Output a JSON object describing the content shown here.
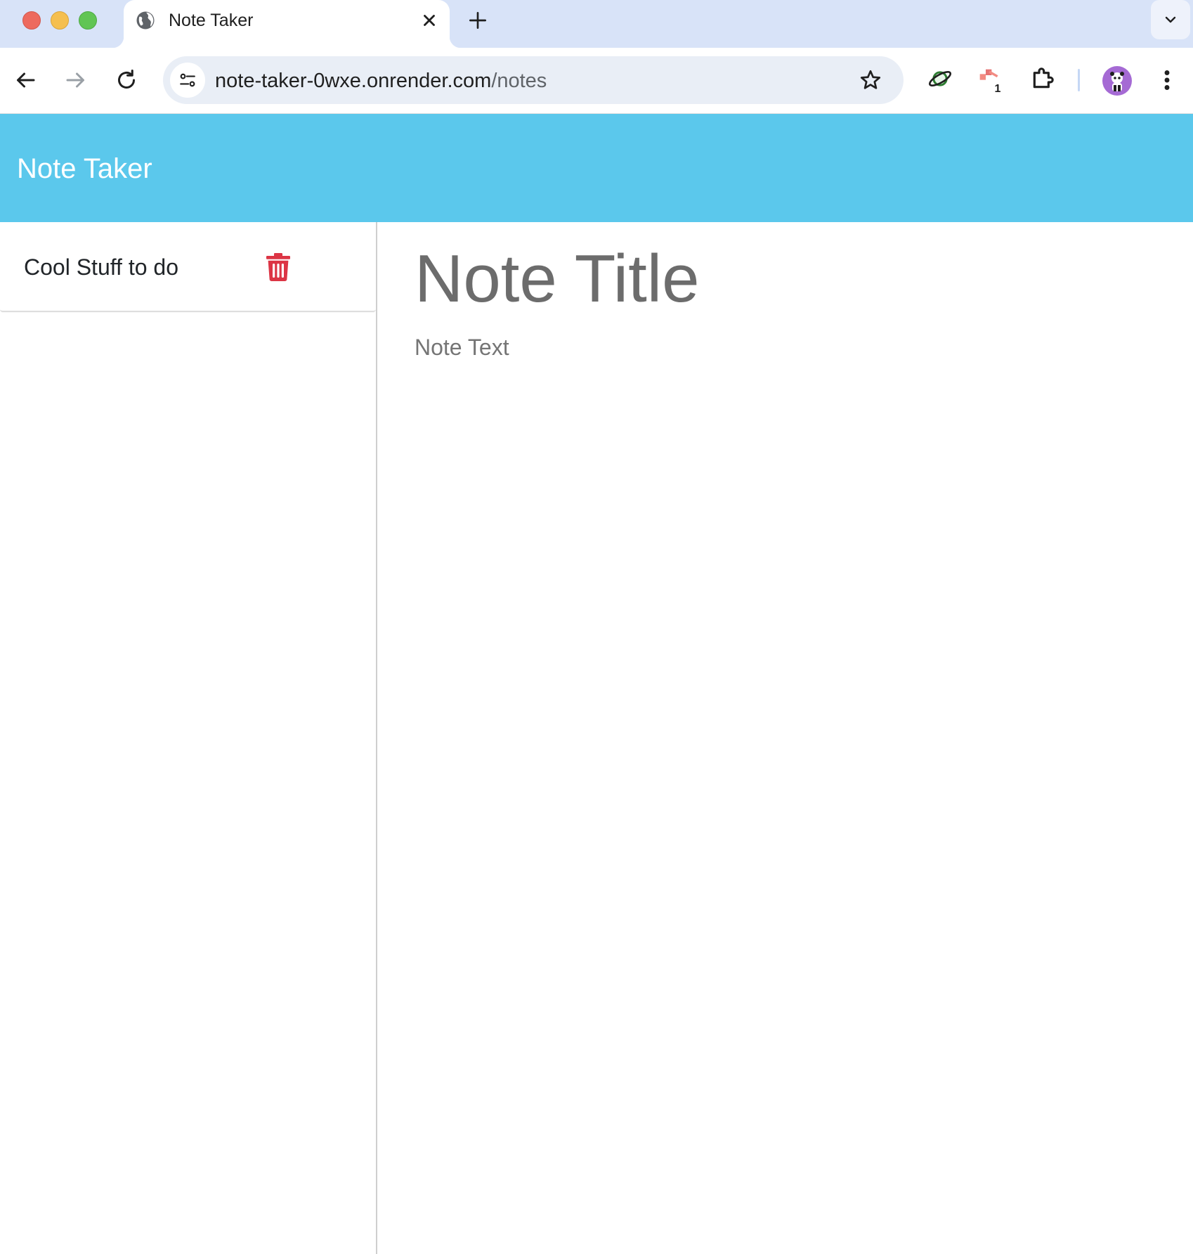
{
  "browser": {
    "tab": {
      "title": "Note Taker",
      "favicon": "globe-icon"
    },
    "url": {
      "host": "note-taker-0wxe.onrender.com",
      "path": "/notes"
    },
    "extension_badge": "1",
    "colors": {
      "tabstrip": "#d8e3f8",
      "omnibox": "#e9eef6",
      "avatar": "#a56ad4"
    }
  },
  "app": {
    "brand": "Note Taker",
    "colors": {
      "navbar": "#5bc8ec",
      "delete_icon": "#dc3545"
    },
    "notes": [
      {
        "title": "Cool Stuff to do"
      }
    ],
    "editor": {
      "title_placeholder": "Note Title",
      "text_placeholder": "Note Text"
    }
  }
}
